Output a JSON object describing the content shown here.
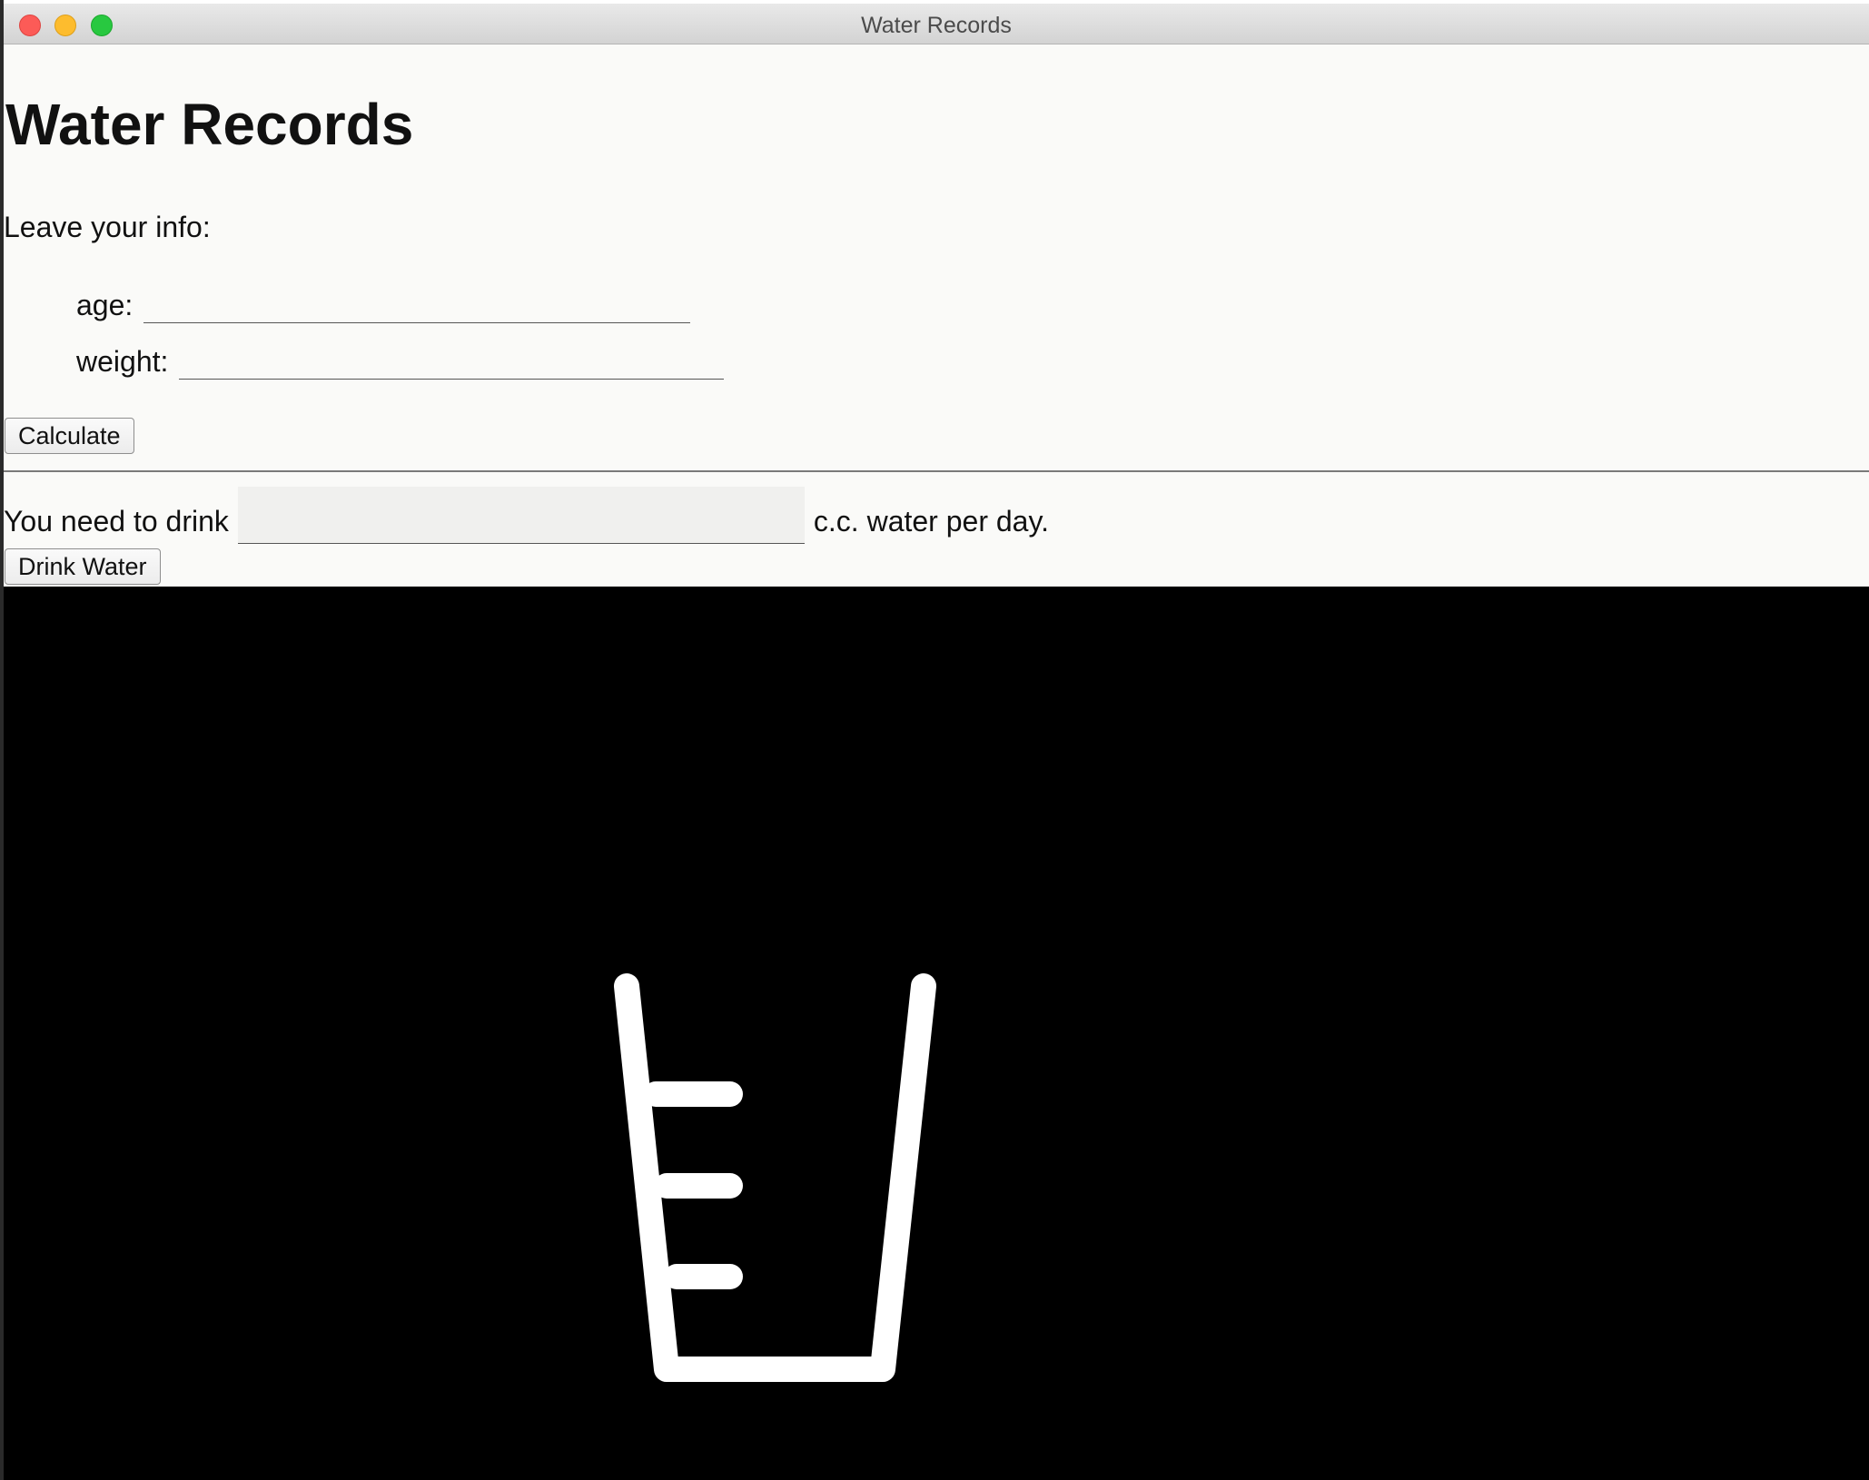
{
  "window": {
    "title": "Water Records"
  },
  "page": {
    "heading": "Water Records",
    "info_prompt": "Leave your info:"
  },
  "form": {
    "age_label": "age:",
    "age_value": "",
    "weight_label": "weight:",
    "weight_value": "",
    "calculate_label": "Calculate"
  },
  "result": {
    "prefix": "You need to drink",
    "value": "",
    "suffix": "c.c. water per day.",
    "drink_label": "Drink Water"
  },
  "canvas": {
    "background": "#000000",
    "cup_color": "#ffffff",
    "icon": "measuring-cup-icon"
  }
}
